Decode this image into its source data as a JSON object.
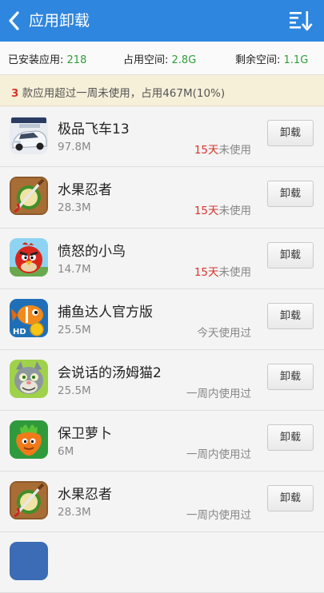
{
  "header": {
    "title": "应用卸载",
    "back_icon": "back-arrow-icon",
    "sort_icon": "sort-descending-icon"
  },
  "stats": {
    "installed_label": "已安装应用:",
    "installed_value": "218",
    "used_label": "占用空间:",
    "used_value": "2.8G",
    "free_label": "剩余空间:",
    "free_value": "1.1G"
  },
  "notice": {
    "count": "3",
    "text": " 款应用超过一周未使用，占用467M(10%)"
  },
  "uninstall_label": "卸载",
  "apps": [
    {
      "name": "极品飞车13",
      "size": "97.8M",
      "days": "15天",
      "usage": "未使用",
      "icon": "race-car-icon"
    },
    {
      "name": "水果忍者",
      "size": "28.3M",
      "days": "15天",
      "usage": "未使用",
      "icon": "fruit-ninja-icon"
    },
    {
      "name": "愤怒的小鸟",
      "size": "14.7M",
      "days": "15天",
      "usage": "未使用",
      "icon": "angry-bird-icon"
    },
    {
      "name": "捕鱼达人官方版",
      "size": "25.5M",
      "days": "",
      "usage": "今天使用过",
      "icon": "fish-icon"
    },
    {
      "name": "会说话的汤姆猫2",
      "size": "25.5M",
      "days": "",
      "usage": "一周内使用过",
      "icon": "tom-cat-icon"
    },
    {
      "name": "保卫萝卜",
      "size": "6M",
      "days": "",
      "usage": "一周内使用过",
      "icon": "carrot-icon"
    },
    {
      "name": "水果忍者",
      "size": "28.3M",
      "days": "",
      "usage": "一周内使用过",
      "icon": "fruit-ninja-icon"
    }
  ]
}
